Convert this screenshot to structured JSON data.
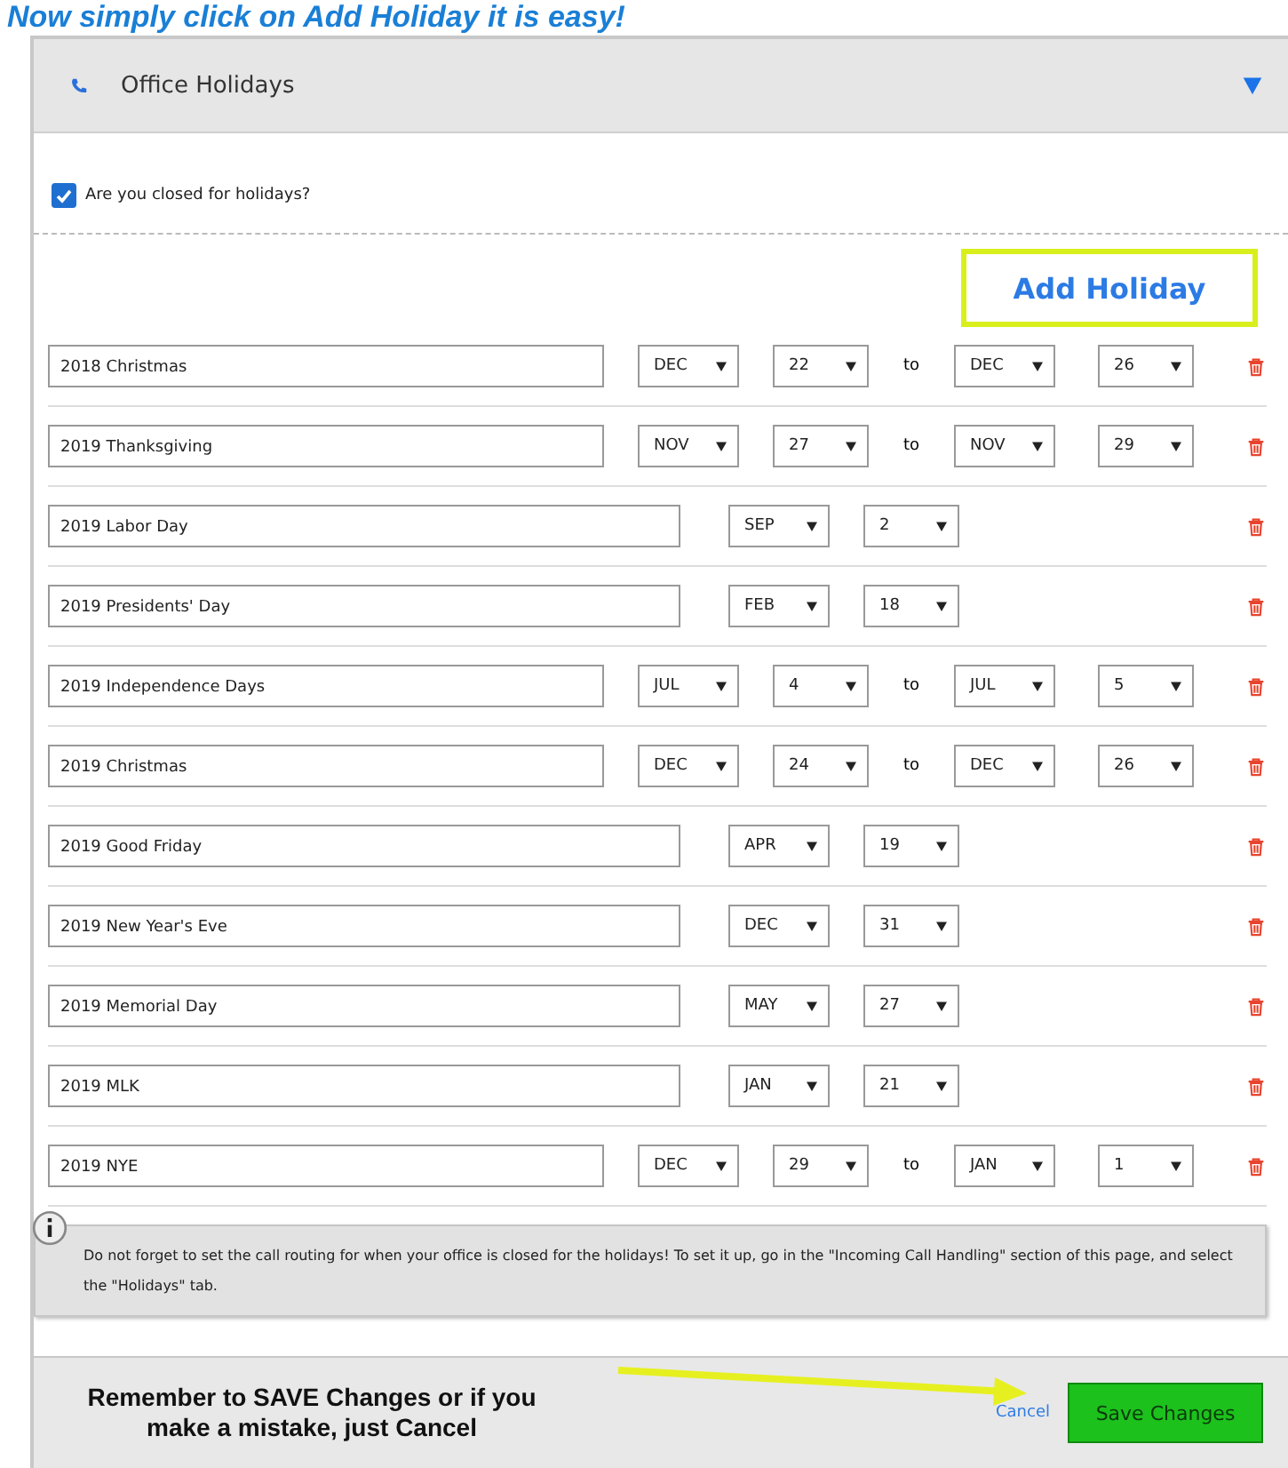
{
  "heading": "Now simply click on Add Holiday it is easy!",
  "panel": {
    "title": "Office Holidays",
    "expanded": true
  },
  "closed_checkbox": {
    "label": "Are you closed for holidays?",
    "checked": true
  },
  "add_button": "Add Holiday",
  "holidays": [
    {
      "kind": "range",
      "name": "2018 Christmas",
      "start_month": "DEC",
      "start_day": "22",
      "separator": "to",
      "end_month": "DEC",
      "end_day": "26"
    },
    {
      "kind": "range",
      "name": "2019 Thanksgiving",
      "start_month": "NOV",
      "start_day": "27",
      "separator": "to",
      "end_month": "NOV",
      "end_day": "29"
    },
    {
      "kind": "single",
      "name": "2019 Labor Day",
      "start_month": "SEP",
      "start_day": "2"
    },
    {
      "kind": "single",
      "name": "2019 Presidents' Day",
      "start_month": "FEB",
      "start_day": "18"
    },
    {
      "kind": "range",
      "name": "2019 Independence Days",
      "start_month": "JUL",
      "start_day": "4",
      "separator": "to",
      "end_month": "JUL",
      "end_day": "5"
    },
    {
      "kind": "range",
      "name": "2019 Christmas",
      "start_month": "DEC",
      "start_day": "24",
      "separator": "to",
      "end_month": "DEC",
      "end_day": "26"
    },
    {
      "kind": "single",
      "name": "2019 Good Friday",
      "start_month": "APR",
      "start_day": "19"
    },
    {
      "kind": "single",
      "name": "2019 New Year's Eve",
      "start_month": "DEC",
      "start_day": "31"
    },
    {
      "kind": "single",
      "name": "2019 Memorial Day",
      "start_month": "MAY",
      "start_day": "27"
    },
    {
      "kind": "single",
      "name": "2019 MLK",
      "start_month": "JAN",
      "start_day": "21"
    },
    {
      "kind": "range",
      "name": "2019 NYE",
      "start_month": "DEC",
      "start_day": "29",
      "separator": "to",
      "end_month": "JAN",
      "end_day": "1"
    }
  ],
  "info_note": "Do not forget to set the call routing for when your office is closed for the holidays! To set it up, go in the \"Incoming Call Handling\" section of this page, and select the \"Holidays\" tab.",
  "annotation": "Remember to SAVE Changes or if you make a mistake, just Cancel",
  "cancel": "Cancel",
  "save": "Save Changes"
}
